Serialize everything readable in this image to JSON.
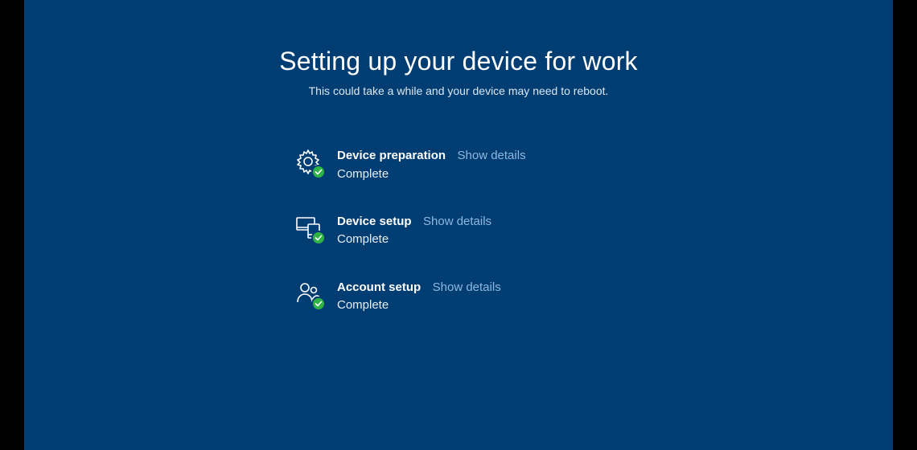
{
  "title": "Setting up your device for work",
  "subtitle": "This could take a while and your device may need to reboot.",
  "steps": [
    {
      "label": "Device preparation",
      "link": "Show details",
      "status": "Complete"
    },
    {
      "label": "Device setup",
      "link": "Show details",
      "status": "Complete"
    },
    {
      "label": "Account setup",
      "link": "Show details",
      "status": "Complete"
    }
  ],
  "colors": {
    "background": "#003d73",
    "link": "#8fb8e0",
    "success": "#2fb344"
  }
}
